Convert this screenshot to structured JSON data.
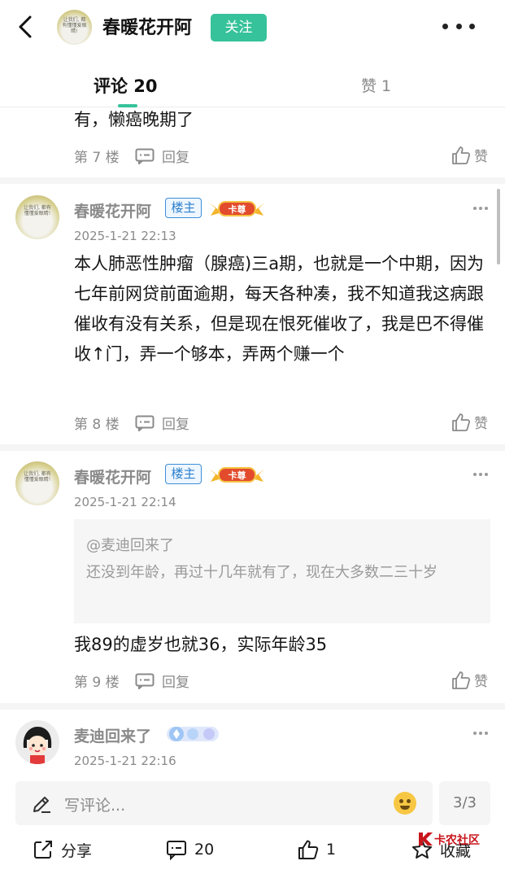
{
  "header": {
    "username": "春暖花开阿",
    "follow_label": "关注",
    "avatar_caption": "让我们, 都有懂懂爱眼睛!"
  },
  "tabs": {
    "comments": "评论 20",
    "likes": "赞 1"
  },
  "comments": [
    {
      "text": "有，懒癌晚期了",
      "floor": "第 7 楼",
      "reply": "回复",
      "like": "赞"
    },
    {
      "author": "春暖花开阿",
      "badge": "楼主",
      "medal": "卡尊",
      "date": "2025-1-21 22:13",
      "text": "本人肺恶性肿瘤（腺癌)三a期，也就是一个中期，因为七年前网贷前面逾期，每天各种凑，我不知道我这病跟催收有没有关系，但是现在恨死催收了，我是巴不得催收↑门，弄一个够本，弄两个赚一个",
      "floor": "第 8 楼",
      "reply": "回复",
      "like": "赞"
    },
    {
      "author": "春暖花开阿",
      "badge": "楼主",
      "medal": "卡尊",
      "date": "2025-1-21 22:14",
      "quote_at": "@麦迪回来了",
      "quote_text": "还没到年龄，再过十几年就有了，现在大多数二三十岁",
      "text": "我89的虚岁也就36，实际年龄35",
      "floor": "第 9 楼",
      "reply": "回复",
      "like": "赞"
    },
    {
      "author": "麦迪回来了",
      "date": "2025-1-21 22:16"
    }
  ],
  "bottom": {
    "placeholder": "写评论...",
    "pager": "3/3",
    "share": "分享",
    "comment_count": "20",
    "like_count": "1",
    "favorite": "收藏",
    "watermark": "卡农社区"
  },
  "colors": {
    "accent": "#36c29a",
    "badge_blue": "#2b7fcc"
  }
}
